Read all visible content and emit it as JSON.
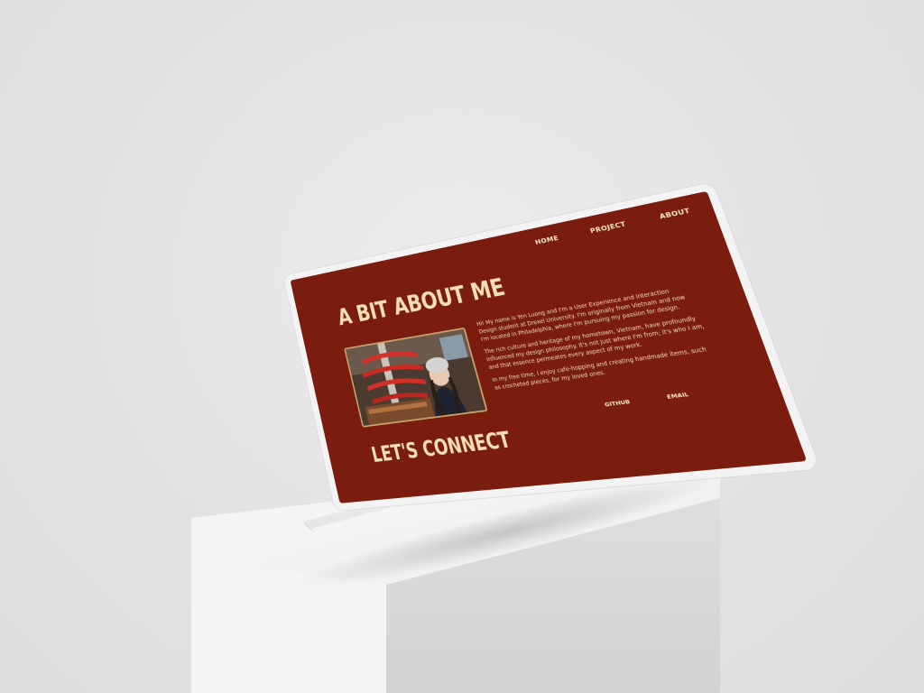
{
  "nav": {
    "home": "HOME",
    "project": "PROJECT",
    "about": "ABOUT"
  },
  "about": {
    "title": "A BIT ABOUT ME",
    "paragraph_1": "Hi! My name is Yen Luong and I'm a User Experience and Interaction Design student at Drexel University. I'm originally from Vietnam and now I'm located in Philadelphia, where I'm pursuing my passion for design.",
    "paragraph_2": "The rich culture and heritage of my hometown, Vietnam, have profoundly influenced my design philosophy. It's not just where I'm from; it's who I am, and that essence permeates every aspect of my work.",
    "paragraph_3": "In my free time, I enjoy cafe-hopping and creating handmade items, such as crocheted pieces, for my loved ones."
  },
  "links": {
    "github": "GITHUB",
    "email": "EMAIL"
  },
  "connect": {
    "title": "LET'S CONNECT"
  },
  "colors": {
    "screen_bg": "#7a1d0f",
    "text_cream": "#f3dfb6",
    "scene_bg": "#e4e4e4"
  }
}
